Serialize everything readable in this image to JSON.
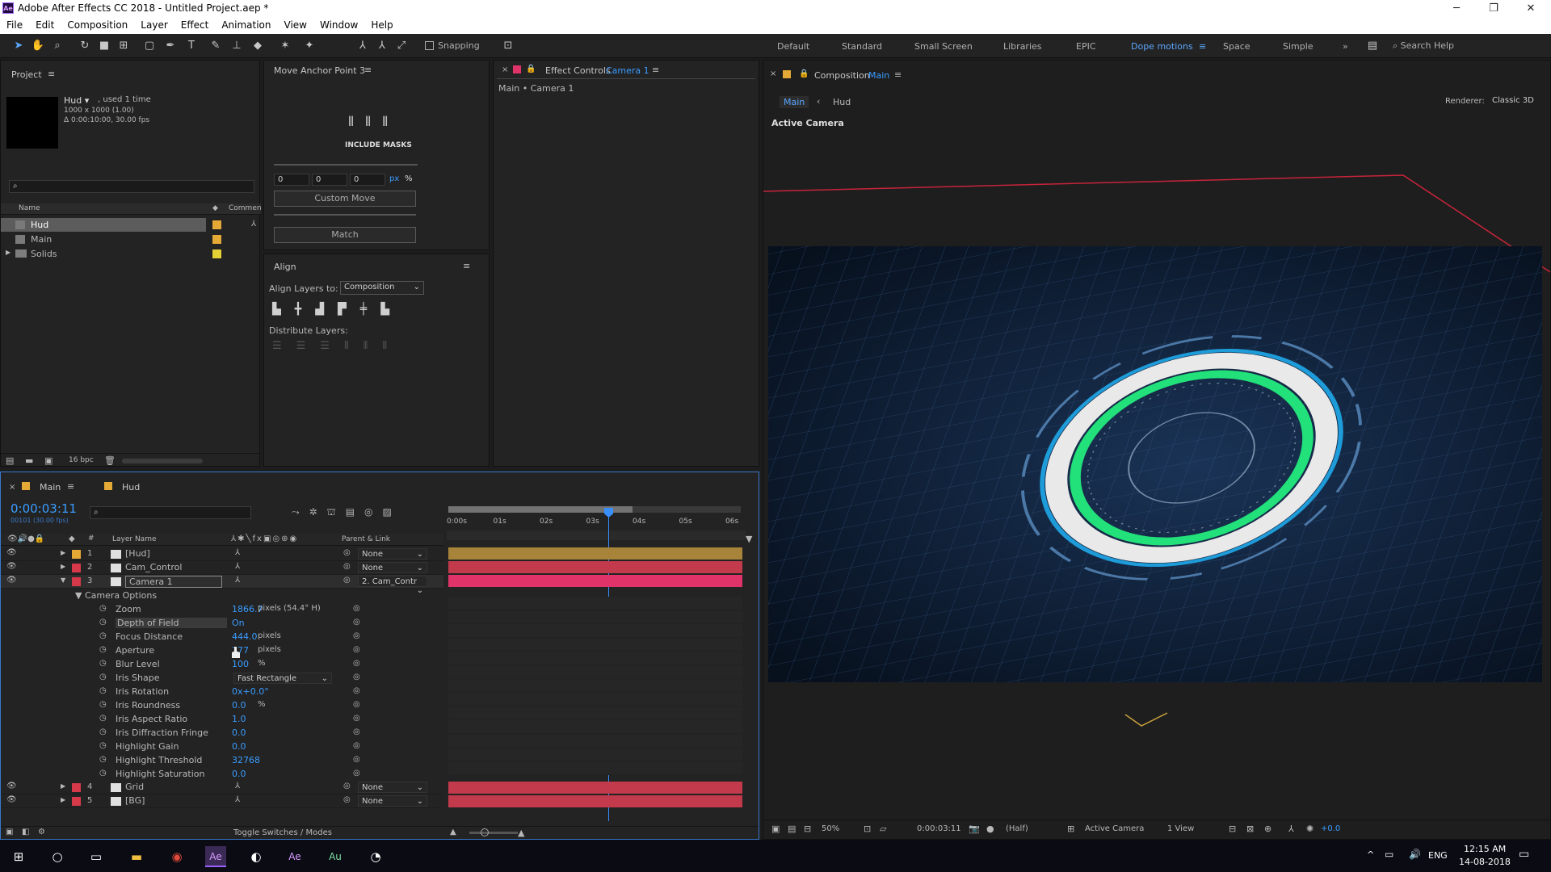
{
  "window": {
    "app_icon": "Ae",
    "title": "Adobe After Effects CC 2018 - Untitled Project.aep *",
    "minimize": "─",
    "maximize": "❐",
    "close": "✕"
  },
  "menu": [
    "File",
    "Edit",
    "Composition",
    "Layer",
    "Effect",
    "Animation",
    "View",
    "Window",
    "Help"
  ],
  "toolbar": {
    "snapping": "Snapping",
    "workspaces": [
      "Default",
      "Standard",
      "Small Screen",
      "Libraries",
      "EPIC",
      "Dope motions",
      "Space",
      "Simple"
    ],
    "active_workspace": "Dope motions",
    "more": "»",
    "search_help": "Search Help"
  },
  "project": {
    "title": "Project",
    "selected_name": "Hud ▾",
    "used": ", used 1 time",
    "dims": "1000 x 1000 (1.00)",
    "duration": "Δ 0:00:10:00, 30.00 fps",
    "col_name": "Name",
    "col_comment": "Commen",
    "items": [
      {
        "name": "Hud",
        "color": "#e5a935"
      },
      {
        "name": "Main",
        "color": "#e5a935"
      },
      {
        "name": "Solids",
        "color": "#e5d035"
      }
    ],
    "bpc": "16 bpc"
  },
  "anchor": {
    "title": "Move Anchor Point 3",
    "include_masks": "INCLUDE MASKS",
    "x": "0",
    "y": "0",
    "z": "0",
    "unit_px": "px",
    "unit_pct": "%",
    "custom_move": "Custom Move",
    "match": "Match"
  },
  "align": {
    "title": "Align",
    "align_layers_to": "Align Layers to:",
    "target": "Composition",
    "distribute": "Distribute Layers:"
  },
  "effects": {
    "title": "Effect Controls",
    "layer": "Camera 1",
    "subtitle": "Main • Camera 1"
  },
  "comp": {
    "title": "Composition",
    "name": "Main",
    "tab_main": "Main",
    "tab_hud": "Hud",
    "renderer_label": "Renderer:",
    "renderer": "Classic 3D",
    "active_camera": "Active Camera",
    "zoom": "50%",
    "time": "0:00:03:11",
    "resolution": "(Half)",
    "view": "Active Camera",
    "views": "1 View",
    "exposure": "+0.0"
  },
  "timeline": {
    "tab_main": "Main",
    "tab_hud": "Hud",
    "timecode": "0:00:03:11",
    "fps": "00101 (30.00 fps)",
    "col_layer": "Layer Name",
    "col_parent": "Parent & Link",
    "ticks": [
      "0:00s",
      "01s",
      "02s",
      "03s",
      "04s",
      "05s",
      "06s"
    ],
    "toggle": "Toggle Switches / Modes",
    "layers": [
      {
        "num": "1",
        "name": "[Hud]",
        "label": "#e5a935",
        "parent": "None",
        "bar": "#a8843b"
      },
      {
        "num": "2",
        "name": "Cam_Control",
        "label": "#d63a4a",
        "parent": "None",
        "bar": "#c23a4b"
      },
      {
        "num": "3",
        "name": "Camera 1",
        "label": "#d63a4a",
        "parent": "2. Cam_Contr",
        "bar": "#e0336a"
      }
    ],
    "camera_options": "Camera Options",
    "props": [
      {
        "name": "Zoom",
        "value": "1866.7",
        "unit": "pixels (54.4° H)"
      },
      {
        "name": "Depth of Field",
        "value": "On",
        "unit": ""
      },
      {
        "name": "Focus Distance",
        "value": "444.0",
        "unit": "pixels"
      },
      {
        "name": "Aperture",
        "value": "177",
        "unit": "pixels"
      },
      {
        "name": "Blur Level",
        "value": "100",
        "unit": "%"
      },
      {
        "name": "Iris Shape",
        "value": "Fast Rectangle",
        "unit": ""
      },
      {
        "name": "Iris Rotation",
        "value": "0x+0.0°",
        "unit": ""
      },
      {
        "name": "Iris Roundness",
        "value": "0.0",
        "unit": "%"
      },
      {
        "name": "Iris Aspect Ratio",
        "value": "1.0",
        "unit": ""
      },
      {
        "name": "Iris Diffraction Fringe",
        "value": "0.0",
        "unit": ""
      },
      {
        "name": "Highlight Gain",
        "value": "0.0",
        "unit": ""
      },
      {
        "name": "Highlight Threshold",
        "value": "32768",
        "unit": ""
      },
      {
        "name": "Highlight Saturation",
        "value": "0.0",
        "unit": ""
      }
    ],
    "layers_bottom": [
      {
        "num": "4",
        "name": "Grid",
        "label": "#d63a4a",
        "parent": "None",
        "bar": "#c23a4b"
      },
      {
        "num": "5",
        "name": "[BG]",
        "label": "#d63a4a",
        "parent": "None",
        "bar": "#c23a4b"
      }
    ]
  },
  "taskbar": {
    "lang": "ENG",
    "time": "12:15 AM",
    "date": "14-08-2018",
    "apps": [
      "Ae",
      "Ae",
      "Au"
    ]
  }
}
